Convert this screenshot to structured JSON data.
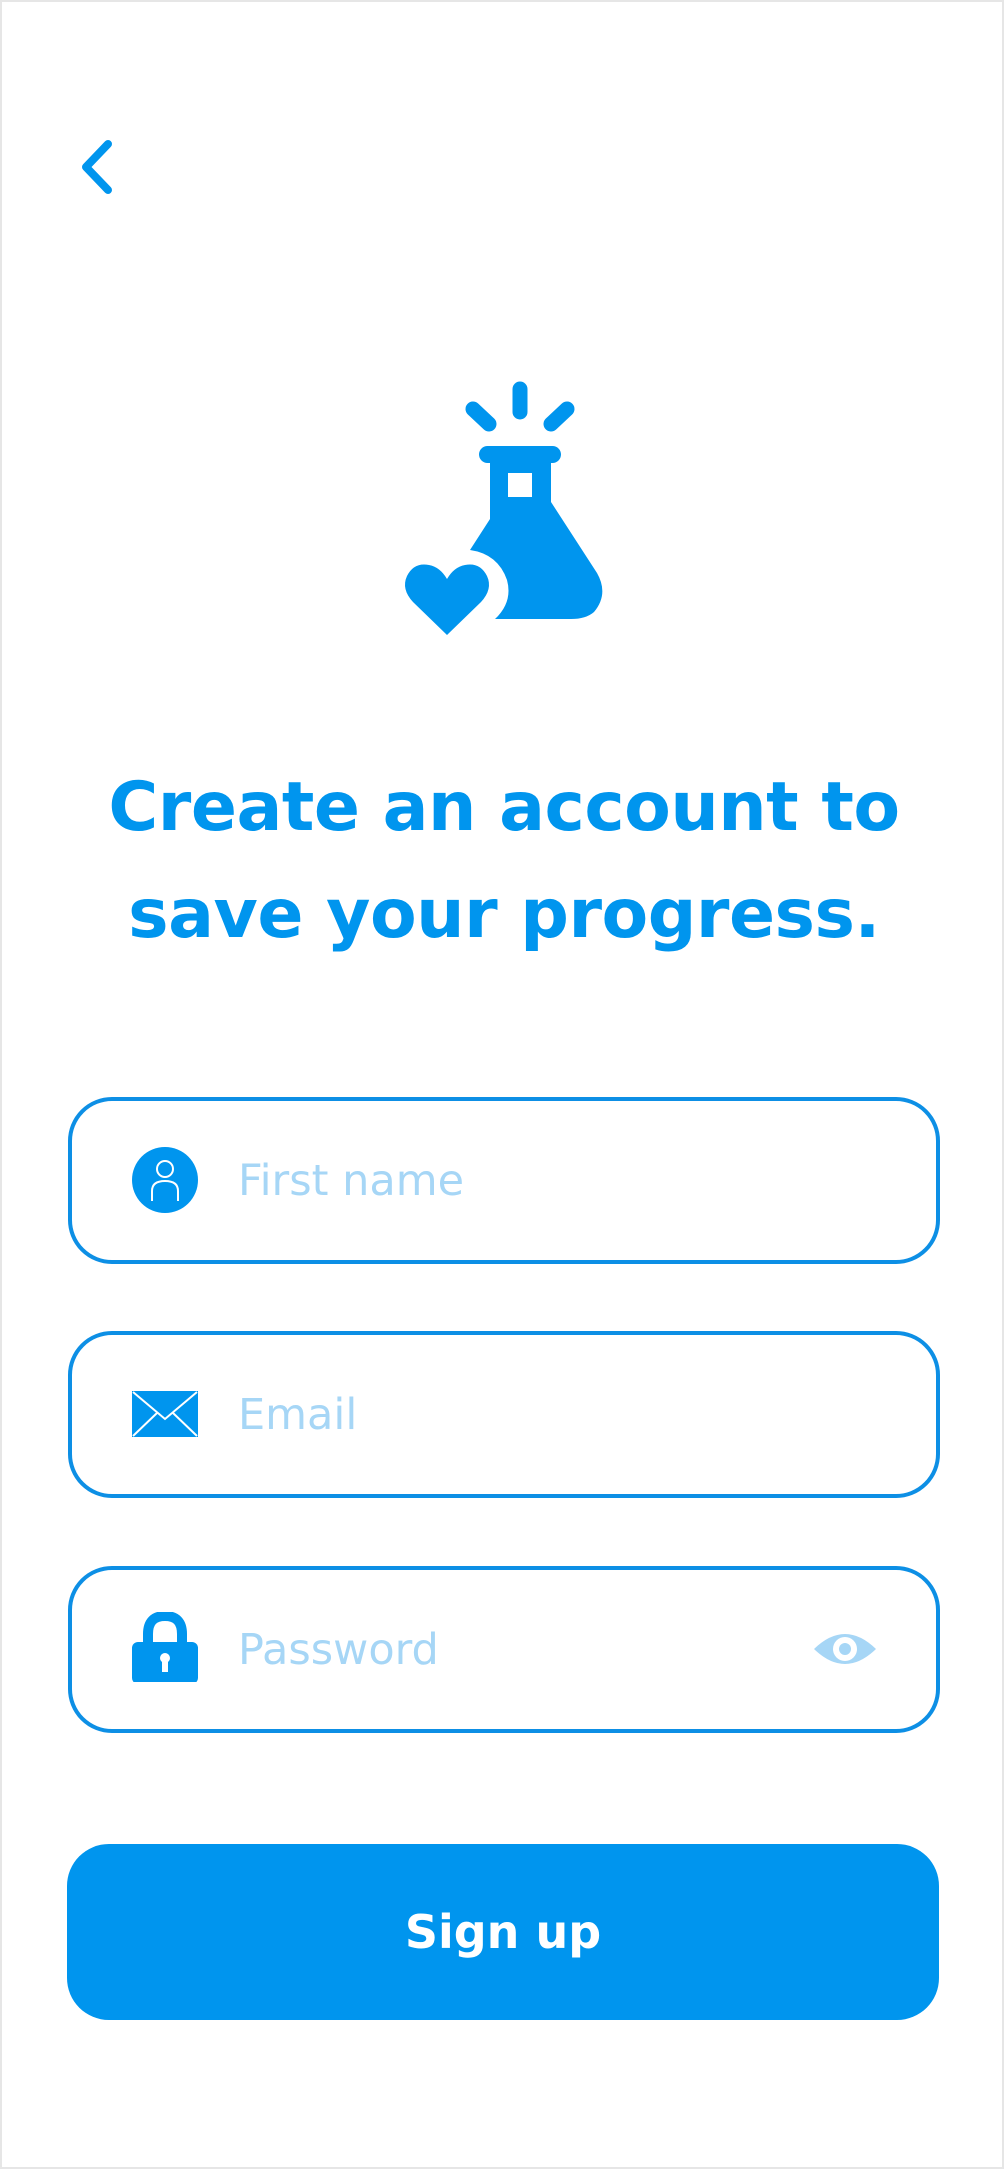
{
  "nav": {
    "back_icon": "chevron-left-icon"
  },
  "hero": {
    "icon": "flask-heart-icon"
  },
  "headline": {
    "line1": "Create an account to",
    "line2": "save your progress."
  },
  "form": {
    "first_name": {
      "icon": "user-icon",
      "placeholder": "First name",
      "value": ""
    },
    "email": {
      "icon": "envelope-icon",
      "placeholder": "Email",
      "value": ""
    },
    "password": {
      "icon": "lock-icon",
      "placeholder": "Password",
      "value": "",
      "toggle_icon": "eye-icon"
    }
  },
  "signup_button": {
    "label": "Sign up"
  },
  "colors": {
    "accent": "#0095ee",
    "field_border": "#0d8fe5",
    "placeholder": "#a6d6f6",
    "frame_border": "#e6e6e6"
  }
}
